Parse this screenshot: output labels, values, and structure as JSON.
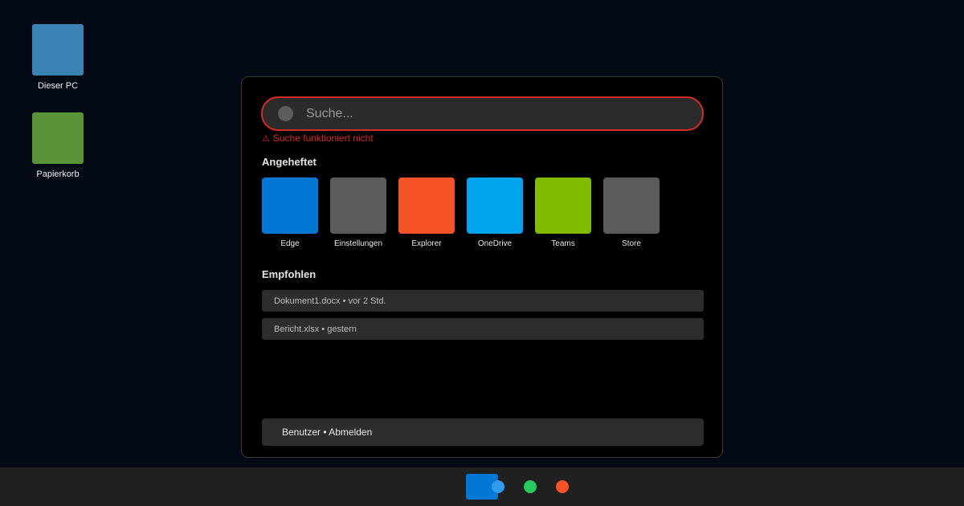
{
  "desktop": {
    "icons": [
      {
        "label": "Dieser PC",
        "color": "#3b82b4"
      },
      {
        "label": "Papierkorb",
        "color": "#5a943a"
      }
    ]
  },
  "start_menu": {
    "search": {
      "placeholder": "Suche...",
      "border_color": "#d42c22",
      "error_text": "Suche funktioniert nicht",
      "error_icon": "warning-icon"
    },
    "pinned": {
      "heading": "Angeheftet",
      "apps": [
        {
          "label": "Edge",
          "color": "#0178d4"
        },
        {
          "label": "Einstellungen",
          "color": "#5b5b5b"
        },
        {
          "label": "Explorer",
          "color": "#f55225"
        },
        {
          "label": "OneDrive",
          "color": "#01a4ef"
        },
        {
          "label": "Teams",
          "color": "#80bb00"
        },
        {
          "label": "Store",
          "color": "#5b5b5b"
        }
      ]
    },
    "recommended": {
      "heading": "Empfohlen",
      "items": [
        {
          "label": "Dokument1.docx • vor 2 Std."
        },
        {
          "label": "Bericht.xlsx • gestern"
        }
      ]
    },
    "user_bar": {
      "label": "Benutzer • Abmelden"
    }
  },
  "taskbar": {
    "start_button_color": "#0178d4",
    "icons": [
      {
        "name": "taskbar-app-blue-icon",
        "color": "#2f9bf1"
      },
      {
        "name": "taskbar-app-green-icon",
        "color": "#24cc5e"
      },
      {
        "name": "taskbar-app-orange-icon",
        "color": "#f55225"
      }
    ]
  }
}
